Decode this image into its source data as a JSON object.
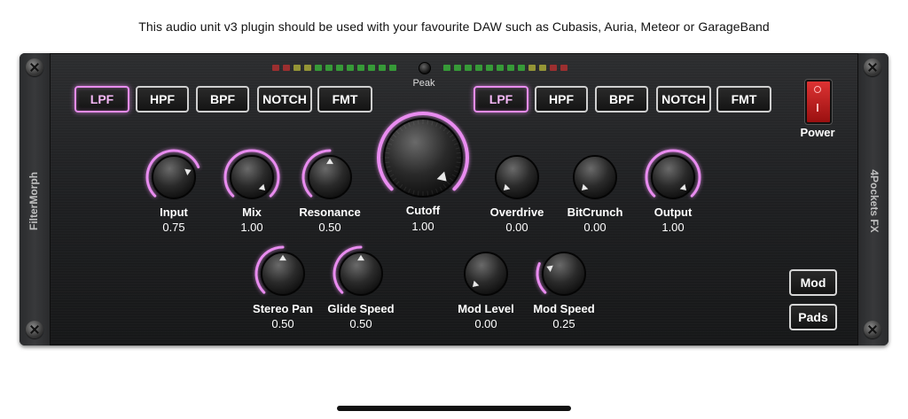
{
  "notice": "This audio unit v3 plugin should be used with your favourite DAW such as Cubasis, Auria, Meteor or GarageBand",
  "plugin": {
    "name": "FilterMorph",
    "vendor": "4Pockets FX",
    "peak_label": "Peak",
    "power_label": "Power",
    "mod_label": "Mod",
    "pads_label": "Pads"
  },
  "filter_left": [
    {
      "label": "LPF",
      "active": true
    },
    {
      "label": "HPF",
      "active": false
    },
    {
      "label": "BPF",
      "active": false
    },
    {
      "label": "NOTCH",
      "active": false
    },
    {
      "label": "FMT",
      "active": false
    }
  ],
  "filter_right": [
    {
      "label": "LPF",
      "active": true
    },
    {
      "label": "HPF",
      "active": false
    },
    {
      "label": "BPF",
      "active": false
    },
    {
      "label": "NOTCH",
      "active": false
    },
    {
      "label": "FMT",
      "active": false
    }
  ],
  "knobs": [
    {
      "name": "input",
      "label": "Input",
      "value": "0.75",
      "level": 0.75
    },
    {
      "name": "mix",
      "label": "Mix",
      "value": "1.00",
      "level": 1.0
    },
    {
      "name": "resonance",
      "label": "Resonance",
      "value": "0.50",
      "level": 0.5
    },
    {
      "name": "cutoff",
      "label": "Cutoff",
      "value": "1.00",
      "level": 1.0
    },
    {
      "name": "overdrive",
      "label": "Overdrive",
      "value": "0.00",
      "level": 0.0
    },
    {
      "name": "bitcrunch",
      "label": "BitCrunch",
      "value": "0.00",
      "level": 0.0
    },
    {
      "name": "output",
      "label": "Output",
      "value": "1.00",
      "level": 1.0
    },
    {
      "name": "stereo-pan",
      "label": "Stereo Pan",
      "value": "0.50",
      "level": 0.5
    },
    {
      "name": "glide-speed",
      "label": "Glide Speed",
      "value": "0.50",
      "level": 0.5
    },
    {
      "name": "mod-level",
      "label": "Mod Level",
      "value": "0.00",
      "level": 0.0
    },
    {
      "name": "mod-speed",
      "label": "Mod Speed",
      "value": "0.25",
      "level": 0.25
    }
  ],
  "colors": {
    "accent_pink": "#e98cf0",
    "led_green": "#3bbf3b",
    "led_yellow": "#b8b838",
    "led_red": "#c23030",
    "power_red": "#cc2222"
  }
}
